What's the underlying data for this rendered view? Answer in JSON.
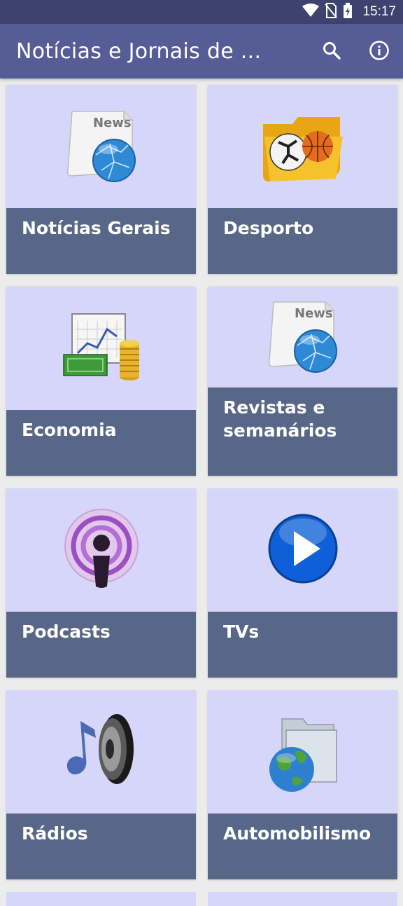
{
  "status": {
    "time": "15:17",
    "icons": [
      "wifi-icon",
      "no-sim-icon",
      "battery-charging-icon"
    ]
  },
  "appbar": {
    "title": "Notícias e Jornais de ...",
    "actions": [
      "search-icon",
      "info-icon"
    ]
  },
  "categories": [
    {
      "label": "Notícias Gerais",
      "icon": "news-globe-icon"
    },
    {
      "label": "Desporto",
      "icon": "sports-folder-icon"
    },
    {
      "label": "Economia",
      "icon": "finance-chart-icon"
    },
    {
      "label": "Revistas e semanários",
      "icon": "news-globe-icon"
    },
    {
      "label": "Podcasts",
      "icon": "podcast-icon"
    },
    {
      "label": "TVs",
      "icon": "play-icon"
    },
    {
      "label": "Rádios",
      "icon": "speaker-music-icon"
    },
    {
      "label": "Automobilismo",
      "icon": "globe-folder-icon"
    }
  ],
  "colors": {
    "statusbar": "#3d426e",
    "appbar": "#565c96",
    "card_top": "#d6d6fa",
    "card_band": "#586688",
    "background": "#ececec"
  }
}
